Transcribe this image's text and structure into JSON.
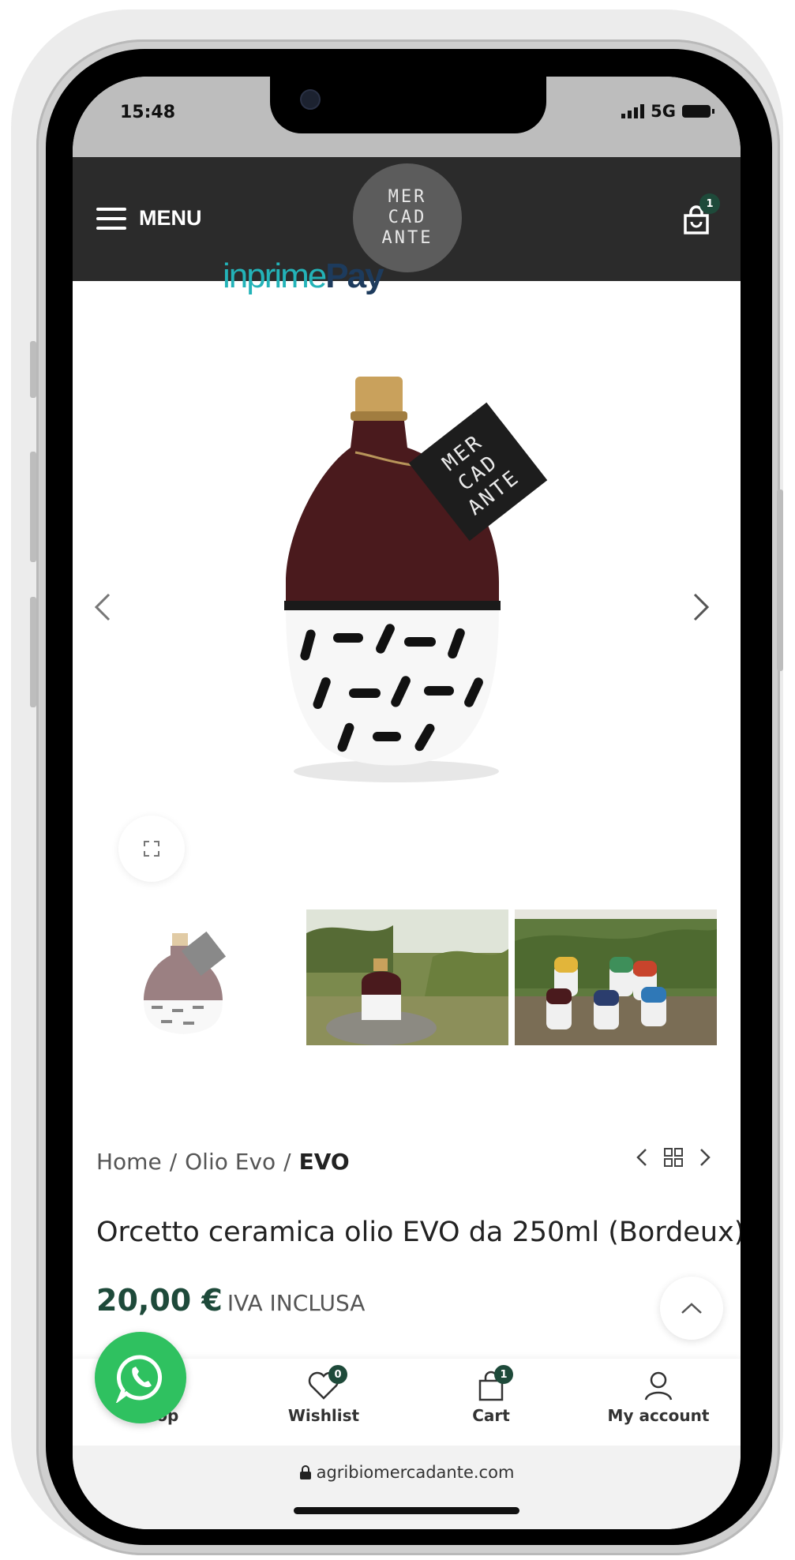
{
  "status": {
    "time": "15:48",
    "network": "5G"
  },
  "header": {
    "menu_label": "MENU",
    "logo_lines": [
      "MER",
      "CAD",
      "ANTE"
    ],
    "cart_count": "1"
  },
  "banner": {
    "brand_part1": "inprime",
    "brand_part2": "Pay"
  },
  "gallery": {
    "main_image_logo_lines": [
      "MER",
      "CAD",
      "ANTE"
    ]
  },
  "breadcrumb": {
    "home": "Home",
    "category": "Olio Evo",
    "current": "EVO",
    "separator": "/"
  },
  "product": {
    "title": "Orcetto ceramica olio EVO da 250ml (Bordeux)",
    "price": "20,00 €",
    "vat_label": "IVA INCLUSA"
  },
  "bottom_nav": {
    "shop": "Shop",
    "wishlist": "Wishlist",
    "wishlist_count": "0",
    "cart": "Cart",
    "cart_count": "1",
    "account": "My account"
  },
  "browser": {
    "url": "agribiomercadante.com"
  },
  "colors": {
    "header_bg": "#2b2b2b",
    "accent_green": "#1e4a3a",
    "whatsapp_green": "#2fc160",
    "brand_teal": "#23b3b8",
    "brand_navy": "#1d3b5d"
  },
  "icons": [
    "menu-icon",
    "shopping-bag-icon",
    "chevron-left-icon",
    "chevron-right-icon",
    "expand-icon",
    "grid-icon",
    "chevron-up-icon",
    "heart-icon",
    "user-icon",
    "whatsapp-icon",
    "lock-icon"
  ]
}
